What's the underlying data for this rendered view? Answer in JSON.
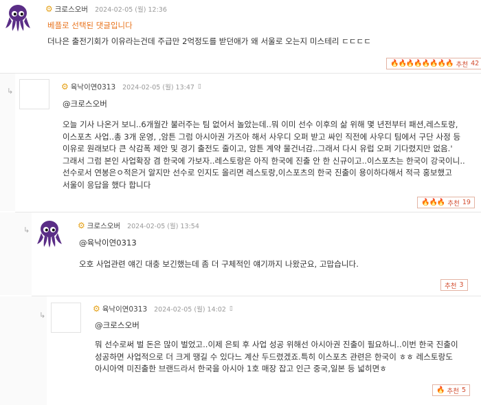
{
  "comments": [
    {
      "nickname": "크로스오버",
      "timestamp": "2024-02-05 (월) 12:36",
      "badge": "베플로 선택된 댓글입니다",
      "text": "더나은 출전기회가 이유라는건데 주급만 2억정도를 받던애가 왜 서울로 오는지 미스테리 ㄷㄷㄷㄷ",
      "fires": "🔥🔥🔥🔥🔥🔥🔥🔥",
      "rec_label": "추천",
      "rec_count": "42",
      "avatar": "squid-avatar-icon"
    },
    {
      "nickname": "육낙이연0313",
      "timestamp": "2024-02-05 (월) 13:47",
      "mobile": "▯",
      "mention": "@크로스오버",
      "text": "오늘 기사 나온거 보니..6개월간 불러주는 팀 없어서 놀았는데..뭐 이미 선수 이후의 삶 위해 몇 년전부터 패션,레스토랑,이스포츠 사업..총 3개 운영, ,암튼 그럼 아시아권 가즈아 해서 사우디 오퍼 받고 싸인 직전에 사우디 팀에서 구단 사정 등 이유로 원래보다 큰 삭감폭 제안 및 경기 출전도 줄이고, 암튼 계약 물건너감..그래서 다시 유럽 오퍼 기다렸지만 없음.' 그래서 그럼 본인 사업확장 겸 한국에 가보자..레스토랑은 아직 한국에 진출 안 한 신규이고..이스포츠는 한국이 강국이니..선수로서 연봉은ㅇ적은거 알지만 선수로 인지도 올리면 레스토랑,이스포츠의 한국 진출이 용이하다해서 적극 홍보했고 서울이 응답을 했다 합니다",
      "fires": "🔥🔥🔥",
      "rec_label": "추천",
      "rec_count": "19"
    },
    {
      "nickname": "크로스오버",
      "timestamp": "2024-02-05 (월) 13:54",
      "mention": "@육낙이연0313",
      "text": "오호 사업관련 얘긴 대충 보긴했는데 좀 더 구체적인 얘기까지 나왔군요, 고맙습니다.",
      "rec_label": "추천",
      "rec_count": "3",
      "avatar": "squid-avatar-icon"
    },
    {
      "nickname": "육낙이연0313",
      "timestamp": "2024-02-05 (월) 14:02",
      "mobile": "▯",
      "mention": "@크로스오버",
      "text": "뭐 선수로써 벌 돈은 많이 벌었고..이제 은퇴 후 사업 성공 위해선 아시아권 진출이 필요하니..이번 한국 진출이 성공하면 사업적으로 더 크게 땡길 수 있다느 계산 두드렸겠죠.특히 이스포츠 관련은 한국이 ㅎㅎ 레스토랑도 아시아역 미진출한 브랜드라서 한국을 아시아 1호 매장 잡고 인근 중국,일본 등 넓히면ㅎ",
      "fires": "🔥",
      "rec_label": "추천",
      "rec_count": "5"
    }
  ],
  "reply_arrow": "↳",
  "gear_icon": "⚙",
  "colors": {
    "accent_orange": "#e8731c",
    "rec_red": "#d24a2c",
    "squid_purple": "#5a2d86"
  }
}
